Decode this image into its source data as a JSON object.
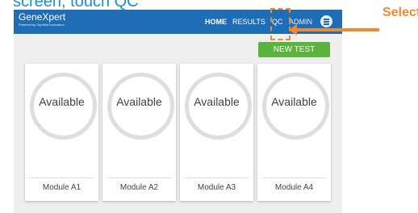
{
  "caption": "screen, touch QC",
  "app": {
    "brand_name": "GeneXpert",
    "brand_sub": "Powered by Cepheid Innovation"
  },
  "nav": {
    "home": "HOME",
    "results": "RESULTS",
    "qc": "QC",
    "admin": "ADMIN",
    "menu_icon": "hamburger-menu-icon"
  },
  "actions": {
    "new_test": "NEW TEST"
  },
  "modules": [
    {
      "status": "Available",
      "label": "Module A1"
    },
    {
      "status": "Available",
      "label": "Module A2"
    },
    {
      "status": "Available",
      "label": "Module A3"
    },
    {
      "status": "Available",
      "label": "Module A4"
    }
  ],
  "annotation": {
    "select_label": "Select",
    "color": "#f08a2c"
  },
  "colors": {
    "topbar": "#1f6eb5",
    "new_test_button": "#5bb23d"
  }
}
